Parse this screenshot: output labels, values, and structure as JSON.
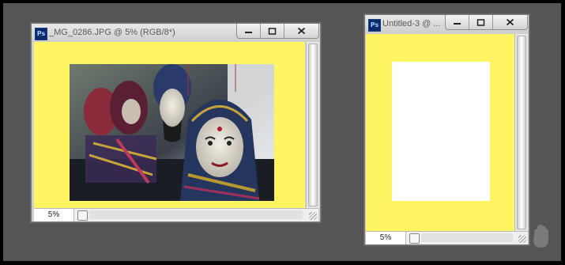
{
  "windows": [
    {
      "title": "_MG_0286.JPG @ 5% (RGB/8*)",
      "zoom": "5%",
      "app_icon": "Ps"
    },
    {
      "title": "Untitled-3 @ ...",
      "zoom": "5%",
      "app_icon": "Ps"
    }
  ],
  "colors": {
    "workspace": "#555555",
    "canvas_background": "#fff563",
    "document_page": "#ffffff"
  },
  "icons": {
    "app": "photoshop-icon",
    "minimize": "minimize-icon",
    "maximize": "maximize-icon",
    "close": "close-icon",
    "status": "document-status-icon",
    "resize": "resize-grip-icon",
    "corner": "hand-icon"
  }
}
